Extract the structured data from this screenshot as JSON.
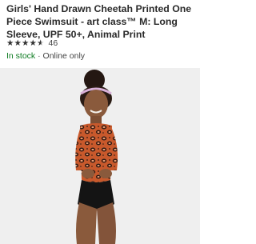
{
  "product": {
    "title_lines": [
      "Girls' Hand Drawn Cheetah Printed One",
      "Piece Swimsuit - art class™ M: Long",
      "Sleeve, UPF 50+, Animal Print"
    ],
    "rating": {
      "stars": 4.5,
      "review_count": "46"
    },
    "availability": {
      "stock": "In stock",
      "separator": " · ",
      "note": "Online only"
    },
    "image": {
      "icon": "product-photo",
      "background": "#efefef"
    }
  },
  "colors": {
    "stock_green": "#0b7a1f",
    "title_text": "#2a2a2a",
    "swimsuit_orange": "#c8592c"
  }
}
